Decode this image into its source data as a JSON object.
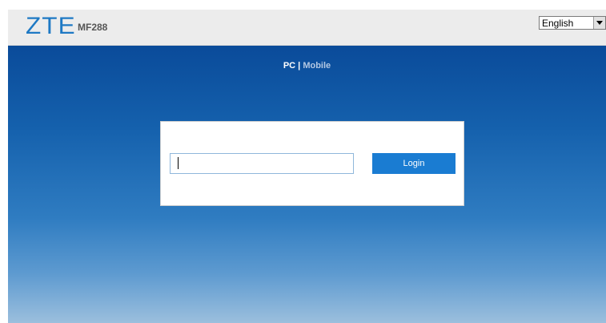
{
  "header": {
    "logo": "ZTE",
    "model": "MF288",
    "language": {
      "selected": "English",
      "icon": "chevron-down-icon"
    }
  },
  "mode_switch": {
    "pc": "PC",
    "separator": "|",
    "mobile": "Mobile"
  },
  "login": {
    "password_value": "",
    "button_label": "Login"
  },
  "colors": {
    "brand_blue": "#1e79c4",
    "button_blue": "#1a7cd2",
    "background_top": "#0a4b9a",
    "background_bottom": "#9bbfdd",
    "header_bg": "#ececec"
  }
}
